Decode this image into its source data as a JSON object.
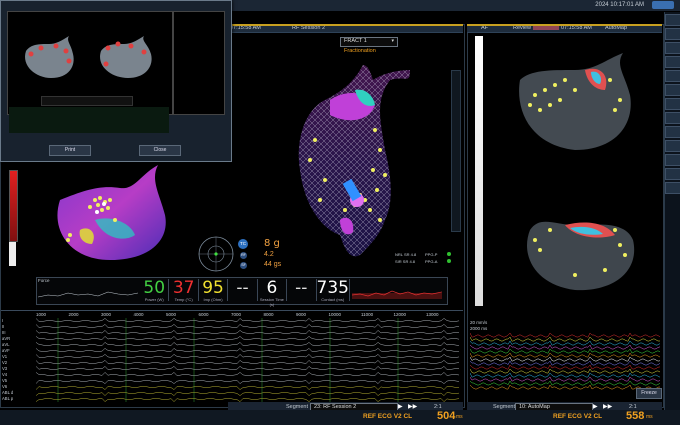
{
  "header": {
    "clock": "2024 10:17:01 AM"
  },
  "left_header": {
    "time": "07:15:58 AM",
    "session": "RF Session 2"
  },
  "right_header": {
    "label": "AF",
    "review": "Review",
    "time": "07:15:58 AM",
    "map": "AutoMap"
  },
  "map_select": {
    "value": "FRACT 1",
    "caption": "Fractionation"
  },
  "popup": {
    "print_label": "Print",
    "close_label": "Close"
  },
  "catheter_panel": {
    "force": "8 g",
    "value2": "4.2",
    "value3": "44 gs",
    "tc_label": "TC",
    "rf_label": "RF",
    "sf_label": "SF"
  },
  "force_strip": {
    "label": "Force"
  },
  "metrics": [
    {
      "value": "50",
      "caption": "Power (W)",
      "color": "#43d043"
    },
    {
      "value": "37",
      "caption": "Temp (°C)",
      "color": "#f03030"
    },
    {
      "value": "95",
      "caption": "Imp (Ohm)",
      "color": "#f0e030"
    },
    {
      "value": "--",
      "caption": "",
      "color": "#e0e0e0"
    },
    {
      "value": "6",
      "caption": "Session Time (s)",
      "color": "#ffffff"
    },
    {
      "value": "--",
      "caption": "",
      "color": "#e0e0e0"
    },
    {
      "value": "735",
      "caption": "Contact (ms)",
      "color": "#ffffff"
    }
  ],
  "status": {
    "nrl": "NRL SR 4.8",
    "nrl2": "SIR SR 4.8",
    "ppg": "PPG-P",
    "ppga": "PPG-A"
  },
  "ecg": {
    "ticks": [
      "1000",
      "2000",
      "3000",
      "4000",
      "5000",
      "6000",
      "7000",
      "8000",
      "9000",
      "10000",
      "11000",
      "12000",
      "13000"
    ],
    "channels": [
      "I",
      "II",
      "III",
      "aVR",
      "aVL",
      "aVF",
      "V1",
      "V2",
      "V3",
      "V4",
      "V5",
      "V6",
      "ABL d",
      "ABL p"
    ]
  },
  "left_segment": {
    "label": "Segment",
    "value": "23: RF Session 2",
    "rate": "2:1"
  },
  "right_segment": {
    "label": "Segment",
    "value": "10: AutoMap",
    "rate": "2:1"
  },
  "right_ecg": {
    "label": "20 mm/s",
    "sub": "2000 ms",
    "freeze": "Freeze"
  },
  "footer": {
    "left_label": "REF ECG V2 CL",
    "left_value": "504",
    "left_unit": "ms",
    "right_label": "REF ECG V2 CL",
    "right_value": "558",
    "right_unit": "ms"
  },
  "colors": {
    "accent": "#f0a020",
    "panel_bg": "#1e2c3c"
  }
}
